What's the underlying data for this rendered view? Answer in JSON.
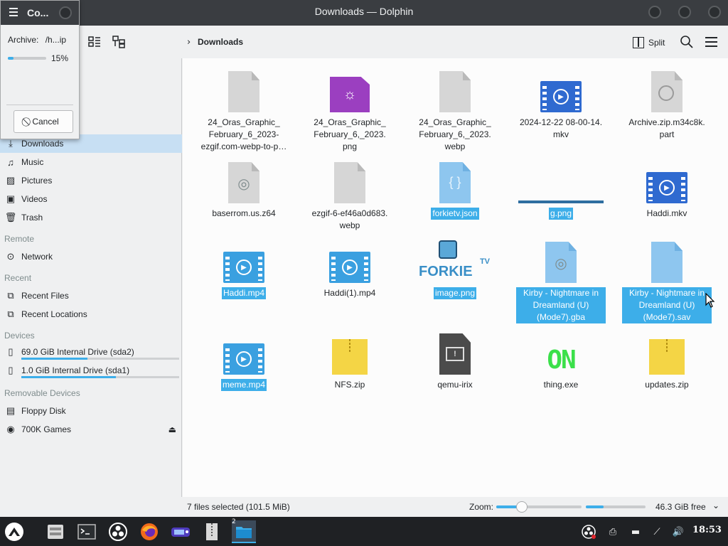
{
  "window": {
    "title": "Downloads — Dolphin"
  },
  "toolbar": {
    "breadcrumb": "Downloads",
    "split_label": "Split"
  },
  "sidebar": {
    "places": [
      {
        "label": "Downloads",
        "icon": "download-icon",
        "selected": true
      },
      {
        "label": "Music",
        "icon": "music-icon"
      },
      {
        "label": "Pictures",
        "icon": "pictures-icon"
      },
      {
        "label": "Videos",
        "icon": "videos-icon"
      },
      {
        "label": "Trash",
        "icon": "trash-icon"
      }
    ],
    "remote_header": "Remote",
    "remote": [
      {
        "label": "Network",
        "icon": "network-icon"
      }
    ],
    "recent_header": "Recent",
    "recent": [
      {
        "label": "Recent Files",
        "icon": "recent-files-icon"
      },
      {
        "label": "Recent Locations",
        "icon": "recent-locations-icon"
      }
    ],
    "devices_header": "Devices",
    "devices": [
      {
        "label": "69.0 GiB Internal Drive (sda2)",
        "icon": "drive-icon",
        "usage": 0.42
      },
      {
        "label": "1.0 GiB Internal Drive (sda1)",
        "icon": "drive-icon",
        "usage": 0.6
      }
    ],
    "removable_header": "Removable Devices",
    "removable": [
      {
        "label": "Floppy Disk",
        "icon": "floppy-icon"
      },
      {
        "label": "700K Games",
        "icon": "disc-icon"
      }
    ]
  },
  "files": [
    {
      "name": "24_Oras_Graphic_ February_6_2023- ezgif.com-webp-to-p…",
      "icon": "generic-file-icon",
      "selected": false
    },
    {
      "name": "24_Oras_Graphic_ February_6,_2023. png",
      "icon": "image-file-icon",
      "selected": false
    },
    {
      "name": "24_Oras_Graphic_ February_6,_2023. webp",
      "icon": "generic-file-icon",
      "selected": false
    },
    {
      "name": "2024-12-22 08-00-14. mkv",
      "icon": "video-file-icon",
      "selected": false
    },
    {
      "name": "Archive.zip.m34c8k. part",
      "icon": "partial-file-icon",
      "selected": false
    },
    {
      "name": "baserrom.us.z64",
      "icon": "rom-file-icon",
      "selected": false
    },
    {
      "name": "ezgif-6-ef46a0d683. webp",
      "icon": "generic-file-icon",
      "selected": false
    },
    {
      "name": "forkietv.json",
      "icon": "json-file-icon",
      "selected": true
    },
    {
      "name": "g.png",
      "icon": "image-thumbnail-icon",
      "selected": true
    },
    {
      "name": "Haddi.mkv",
      "icon": "video-file-icon",
      "selected": false
    },
    {
      "name": "Haddi.mp4",
      "icon": "video-file-icon",
      "selected": true
    },
    {
      "name": "Haddi(1).mp4",
      "icon": "video-file-icon",
      "selected": false
    },
    {
      "name": "image.png",
      "icon": "forkie-tv-thumbnail-icon",
      "selected": true
    },
    {
      "name": "Kirby - Nightmare in Dreamland (U) (Mode7).gba",
      "icon": "rom-file-icon",
      "selected": true
    },
    {
      "name": "Kirby - Nightmare in Dreamland (U) (Mode7).sav",
      "icon": "generic-file-icon",
      "selected": true
    },
    {
      "name": "meme.mp4",
      "icon": "video-file-icon",
      "selected": true
    },
    {
      "name": "NFS.zip",
      "icon": "zip-file-icon",
      "selected": false
    },
    {
      "name": "qemu-irix",
      "icon": "executable-file-icon",
      "selected": false
    },
    {
      "name": "thing.exe",
      "icon": "on-thumbnail-icon",
      "selected": false
    },
    {
      "name": "updates.zip",
      "icon": "zip-file-icon",
      "selected": false
    }
  ],
  "thumb_text": {
    "forkie": "FORKIE",
    "tv": "TV",
    "on": "ON"
  },
  "statusbar": {
    "selection": "7 files selected (101.5 MiB)",
    "zoom_label": "Zoom:",
    "zoom_level": 0.3,
    "free_space": "46.3 GiB free"
  },
  "progress_popup": {
    "title": "Co...",
    "archive_label": "Archive:",
    "archive_path": "/h...ip",
    "percent_text": "15%",
    "progress": 0.15,
    "cancel_label": "Cancel"
  },
  "taskbar": {
    "apps": [
      {
        "name": "launcher-icon"
      },
      {
        "name": "file-manager-icon"
      },
      {
        "name": "terminal-icon"
      },
      {
        "name": "obs-icon"
      },
      {
        "name": "firefox-icon"
      },
      {
        "name": "game-icon"
      },
      {
        "name": "archiver-icon"
      },
      {
        "name": "dolphin-icon",
        "active": true,
        "badge": "2"
      }
    ],
    "clock": "18:53"
  },
  "colors": {
    "accent": "#3daee9",
    "titlebar": "#3a3d41",
    "selection_bg": "#c7dff3",
    "taskbar": "#1f2124"
  }
}
